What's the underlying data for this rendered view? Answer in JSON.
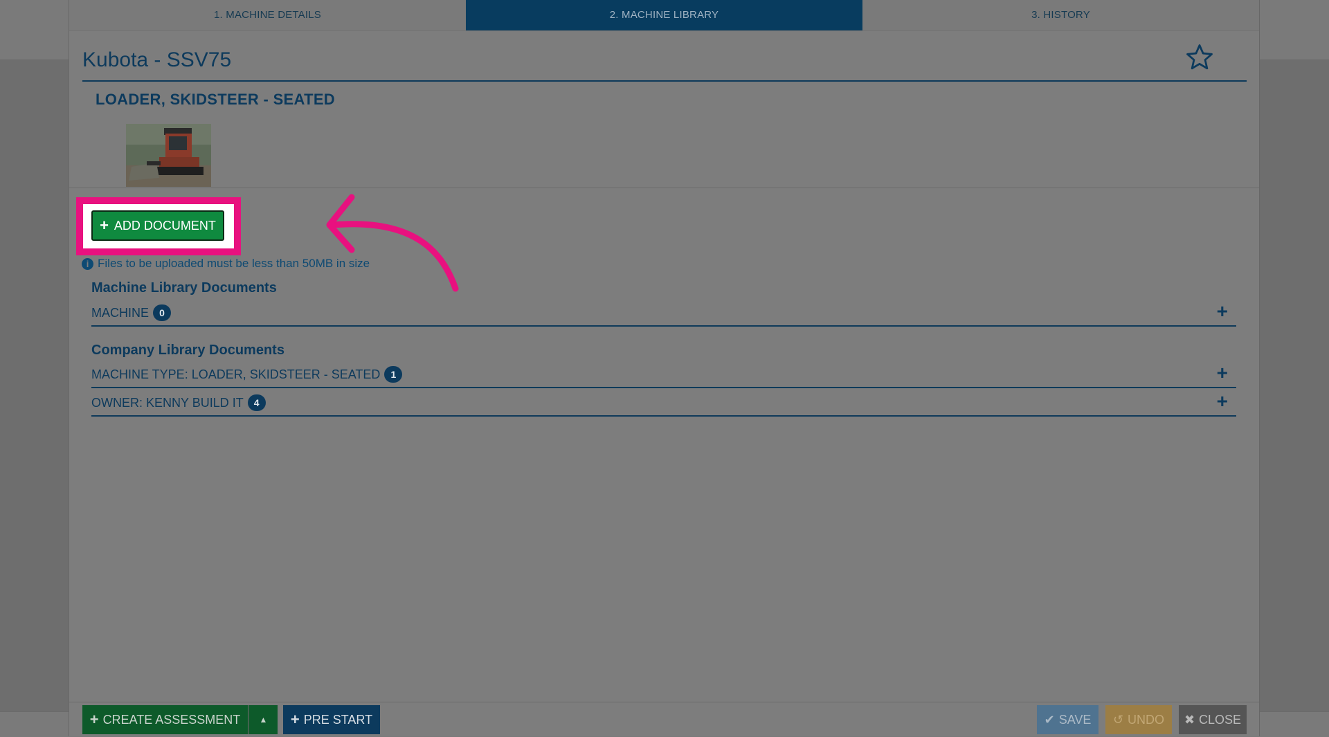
{
  "tabs": [
    {
      "label": "1. MACHINE DETAILS"
    },
    {
      "label": "2. MACHINE LIBRARY"
    },
    {
      "label": "3. HISTORY"
    }
  ],
  "machine": {
    "title": "Kubota - SSV75",
    "type": "LOADER, SKIDSTEER - SEATED"
  },
  "add_document": {
    "label": "ADD DOCUMENT"
  },
  "info_text": "Files to be uploaded must be less than 50MB in size",
  "machine_library": {
    "title": "Machine Library Documents",
    "rows": [
      {
        "label": "MACHINE",
        "count": "0"
      }
    ]
  },
  "company_library": {
    "title": "Company Library Documents",
    "rows": [
      {
        "label": "MACHINE TYPE: LOADER, SKIDSTEER - SEATED",
        "count": "1"
      },
      {
        "label": "OWNER: KENNY BUILD IT",
        "count": "4"
      }
    ]
  },
  "footer": {
    "create_assessment": "CREATE ASSESSMENT",
    "pre_start": "PRE START",
    "save": "SAVE",
    "undo": "UNDO",
    "close": "CLOSE"
  },
  "colors": {
    "accent": "#0c3a5d",
    "highlight": "#e8117f",
    "add_button": "#0f8a3f"
  }
}
